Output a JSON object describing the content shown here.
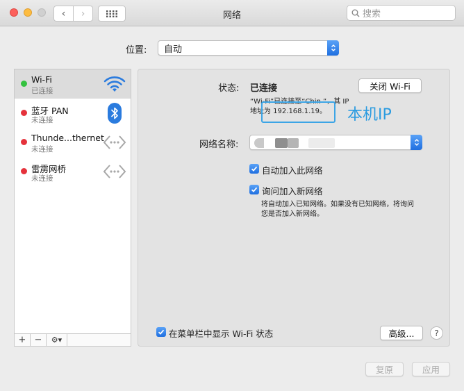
{
  "window": {
    "title": "网络"
  },
  "toolbar": {
    "back_glyph": "‹",
    "forward_glyph": "›",
    "search_placeholder": "搜索"
  },
  "location": {
    "label": "位置:",
    "value": "自动"
  },
  "services": [
    {
      "name": "Wi-Fi",
      "status": "已连接",
      "state": "connected",
      "icon": "wifi-icon"
    },
    {
      "name": "蓝牙 PAN",
      "status": "未连接",
      "state": "disconnected",
      "icon": "bluetooth-icon"
    },
    {
      "name": "Thunde...thernet",
      "status": "未连接",
      "state": "disconnected",
      "icon": "ethernet-icon"
    },
    {
      "name": "雷雳网桥",
      "status": "未连接",
      "state": "disconnected",
      "icon": "ethernet-icon"
    }
  ],
  "sidebar_tools": {
    "add": "+",
    "remove": "−",
    "gear": "⚙▾"
  },
  "detail": {
    "status_label": "状态:",
    "status_value": "已连接",
    "wifi_off_button": "关闭 Wi-Fi",
    "status_desc_line1": "“Wi-Fi”已连接至“Chin                 ”，其 IP",
    "status_desc_line2": "地址为 192.168.1.19。",
    "annotation": "本机IP",
    "network_name_label": "网络名称:",
    "auto_join_label": "自动加入此网络",
    "auto_join_checked": true,
    "ask_join_label": "询问加入新网络",
    "ask_join_checked": true,
    "ask_join_desc_line1": "将自动加入已知网络。如果没有已知网络，将询问",
    "ask_join_desc_line2": "您是否加入新网络。",
    "menubar_label": "在菜单栏中显示 Wi-Fi 状态",
    "menubar_checked": true,
    "advanced_button": "高级...",
    "help_glyph": "?"
  },
  "footer": {
    "revert_button": "复原",
    "apply_button": "应用"
  },
  "colors": {
    "connected": "#34c23f",
    "disconnected": "#e5323b",
    "accent": "#1f6fe0",
    "annotation": "#2a9be0"
  }
}
